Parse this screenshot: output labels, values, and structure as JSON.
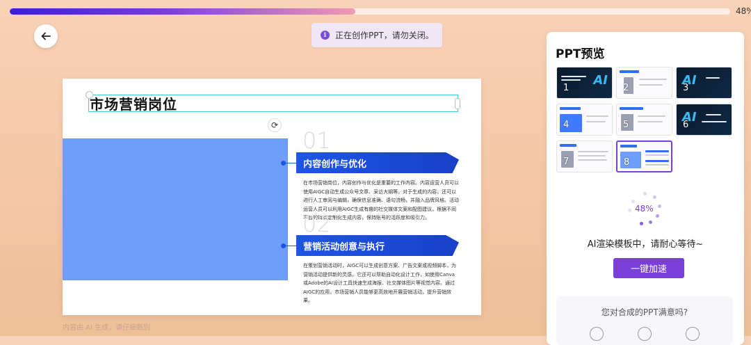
{
  "progress": {
    "percent_label": "48%",
    "value": 0.48
  },
  "toast": {
    "icon": "info-icon",
    "text": "正在创作PPT，请勿关闭。"
  },
  "back_button": {
    "icon": "arrow-left-icon"
  },
  "slide": {
    "title": "市场营销岗位",
    "sections": [
      {
        "number": "01",
        "heading": "内容创作与优化",
        "body": "在市场营销岗位，内容创作与优化是重要的工作内容。内容运营人员可以使用AIGC自动生成公众号文章、采访大纲等。对于生成的内容，还可以进行人工审阅与编辑，确保信息准确、语句流畅，并融入品牌风格。活动运营人员可以利用AIGC生成有趣的社交媒体文案和配图建议，根据不同平台的特点定制化生成内容，保持账号的活跃度和吸引力。"
      },
      {
        "number": "02",
        "heading": "营销活动创意与执行",
        "body": "在策划营销活动时，AIGC可以生成创意方案、广告文案或视频脚本，为营销活动提供新的灵感。它还可以帮助自动化设计工作，如使用Canva或Adobe的AI设计工具快速生成海报、社交媒体图片等视觉内容。通过AIGC的应用，市场营销人员能够更高效地开展营销活动，提升营销效果。"
      }
    ]
  },
  "footnote": "内容由 AI 生成，请仔细甄别",
  "preview": {
    "title": "PPT预览",
    "thumbnails": [
      {
        "num": "1",
        "style": "dark",
        "caption": "如何用AIGC提升工作效率",
        "badge": "AI"
      },
      {
        "num": "2",
        "style": "light",
        "caption": ""
      },
      {
        "num": "3",
        "style": "dark",
        "caption": "AIGC基础认知",
        "badge": "AI"
      },
      {
        "num": "4",
        "style": "light",
        "caption": ""
      },
      {
        "num": "5",
        "style": "light",
        "caption": ""
      },
      {
        "num": "6",
        "style": "dark",
        "caption": "AIGC在工作中的应用",
        "badge": "AI"
      },
      {
        "num": "7",
        "style": "light",
        "caption": ""
      },
      {
        "num": "8",
        "style": "light",
        "caption": "",
        "selected": true
      }
    ],
    "loading_percent": "48%",
    "waiting_text": "AI渲染模板中，请耐心等待~",
    "speed_button": "一键加速",
    "survey_question": "您对合成的PPT满意吗?"
  },
  "colors": {
    "accent": "#7a3fd8",
    "slide_blue": "#1e55e6",
    "block_blue": "#6e9dfc"
  }
}
